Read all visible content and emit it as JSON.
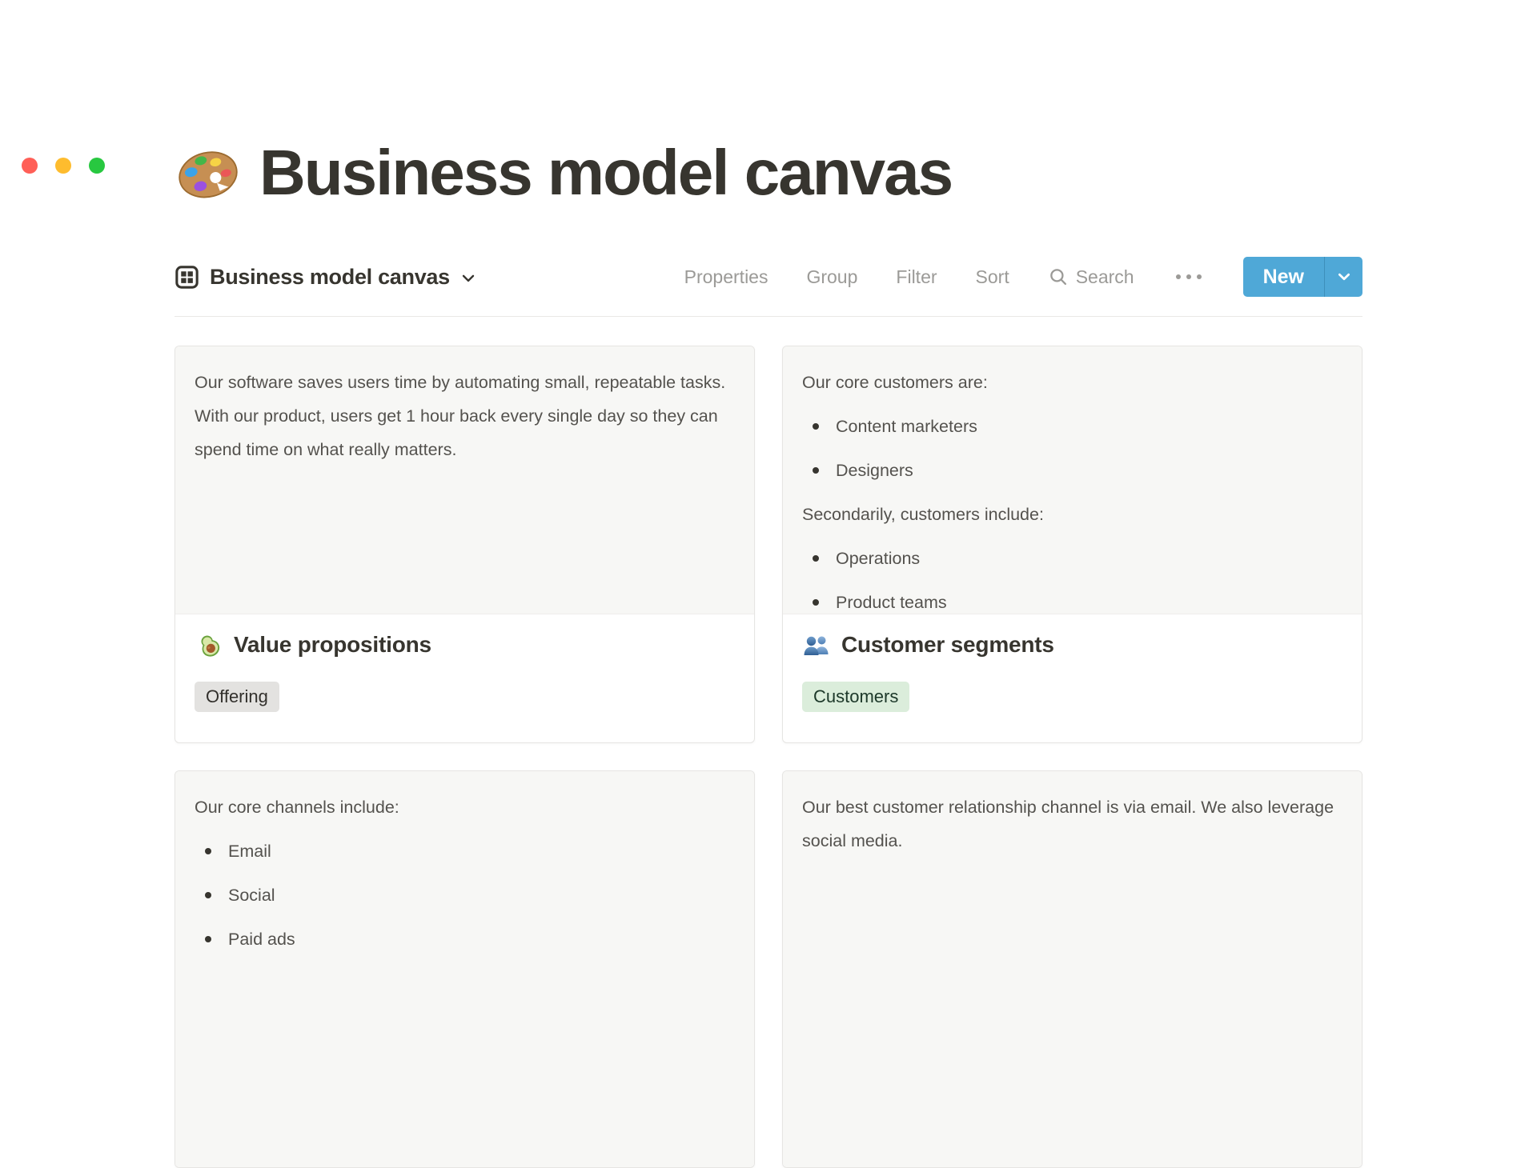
{
  "window": {
    "controls": [
      "close",
      "minimize",
      "maximize"
    ],
    "control_colors": {
      "close": "#FF5F57",
      "minimize": "#FEBC2E",
      "maximize": "#28C840"
    }
  },
  "page": {
    "icon": "artist-palette-emoji",
    "title": "Business model canvas"
  },
  "view_bar": {
    "view_icon": "gallery-view-icon",
    "view_name": "Business model canvas",
    "menu": [
      "Properties",
      "Group",
      "Filter",
      "Sort"
    ],
    "search_label": "Search",
    "more_label": "more-options",
    "new_label": "New",
    "accent_color": "#4FA8D7"
  },
  "cards": [
    {
      "icon": "avocado-emoji",
      "title": "Value propositions",
      "tag": {
        "label": "Offering",
        "bg": "#E3E2E0",
        "color": "#32302C"
      },
      "body": [
        {
          "type": "p",
          "text": "Our software saves users time by automating small, repeatable tasks. With our product, users get 1 hour back every single day so they can spend time on what really matters."
        }
      ]
    },
    {
      "icon": "busts-in-silhouette-emoji",
      "title": "Customer segments",
      "tag": {
        "label": "Customers",
        "bg": "#DBEDDB",
        "color": "#1C3829"
      },
      "body": [
        {
          "type": "p",
          "text": "Our core customers are:"
        },
        {
          "type": "li",
          "text": "Content marketers"
        },
        {
          "type": "li",
          "text": "Designers"
        },
        {
          "type": "p",
          "text": "Secondarily, customers include:"
        },
        {
          "type": "li",
          "text": "Operations"
        },
        {
          "type": "li",
          "text": "Product teams"
        }
      ]
    },
    {
      "body": [
        {
          "type": "p",
          "text": "Our core channels include:"
        },
        {
          "type": "li",
          "text": "Email"
        },
        {
          "type": "li",
          "text": "Social"
        },
        {
          "type": "li",
          "text": "Paid ads"
        }
      ]
    },
    {
      "body": [
        {
          "type": "p",
          "text": "Our best customer relationship channel is via email. We also leverage social media."
        }
      ]
    }
  ]
}
